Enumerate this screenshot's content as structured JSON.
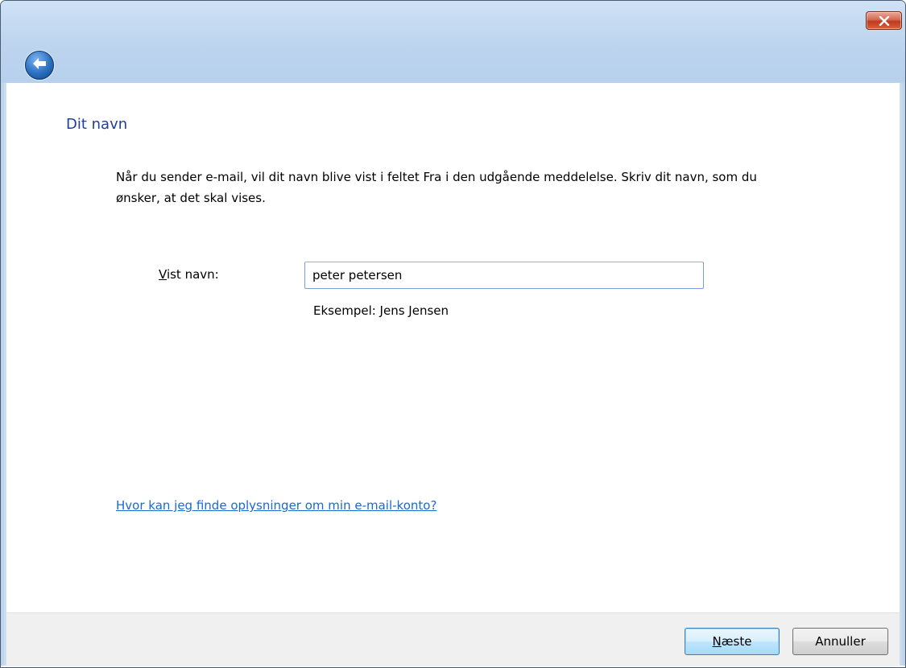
{
  "window": {
    "close_icon": "close-x-icon",
    "back_icon": "back-arrow-icon"
  },
  "page": {
    "title": "Dit navn",
    "description": "Når du sender e-mail, vil dit navn blive vist i feltet Fra i den udgående meddelelse. Skriv dit navn, som du ønsker, at det skal vises."
  },
  "display_name": {
    "label_mnemonic": "V",
    "label_rest": "ist navn:",
    "value": "peter petersen",
    "example": "Eksempel: Jens Jensen"
  },
  "help_link": "Hvor kan jeg finde oplysninger om min e-mail-konto?",
  "buttons": {
    "next_mnemonic": "N",
    "next_rest": "æste",
    "cancel": "Annuller"
  },
  "colors": {
    "title": "#1e3f9a",
    "link": "#1a6ad0",
    "titlebar": "#bcd4ee",
    "close_button": "#c0391c",
    "footer": "#f0f0f0"
  }
}
